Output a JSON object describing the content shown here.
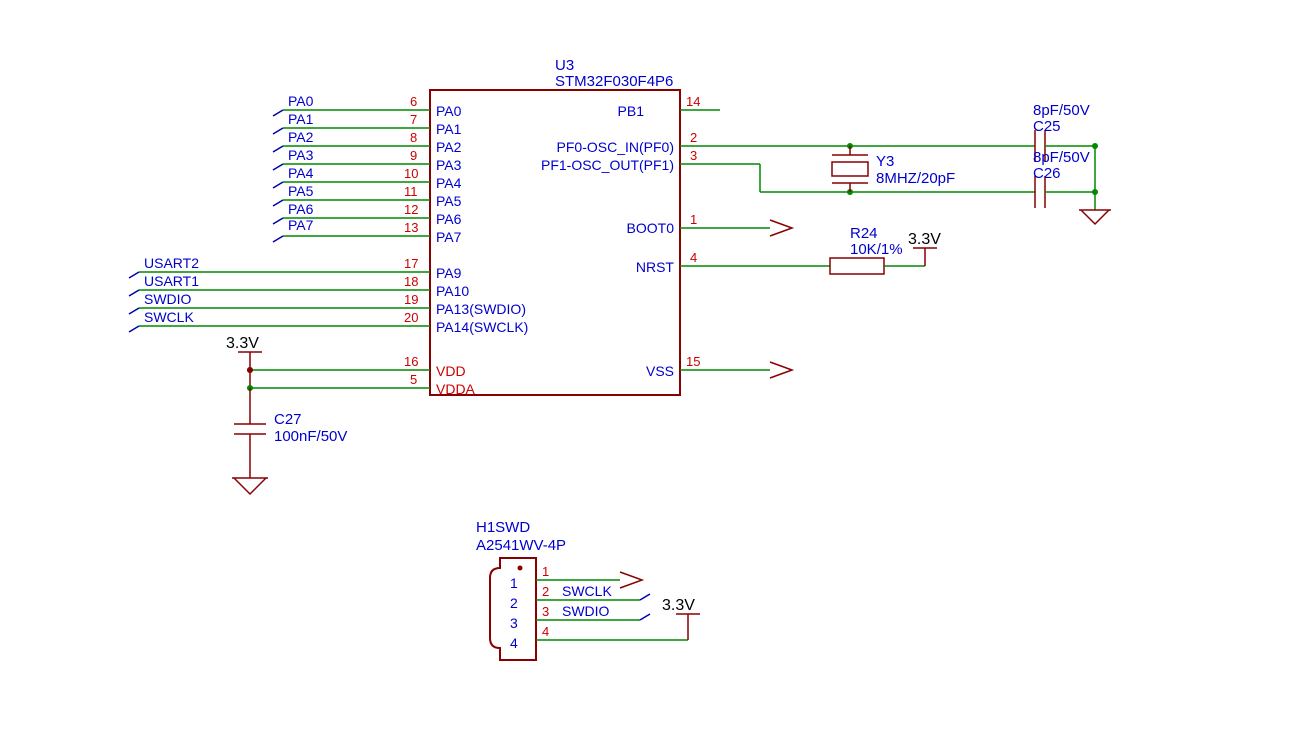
{
  "ic": {
    "ref": "U3",
    "part": "STM32F030F4P6",
    "left_pins": [
      {
        "num": "6",
        "name": "PA0",
        "net": "PA0"
      },
      {
        "num": "7",
        "name": "PA1",
        "net": "PA1"
      },
      {
        "num": "8",
        "name": "PA2",
        "net": "PA2"
      },
      {
        "num": "9",
        "name": "PA3",
        "net": "PA3"
      },
      {
        "num": "10",
        "name": "PA4",
        "net": "PA4"
      },
      {
        "num": "11",
        "name": "PA5",
        "net": "PA5"
      },
      {
        "num": "12",
        "name": "PA6",
        "net": "PA6"
      },
      {
        "num": "13",
        "name": "PA7",
        "net": "PA7"
      },
      {
        "num": "17",
        "name": "PA9",
        "net": "USART2"
      },
      {
        "num": "18",
        "name": "PA10",
        "net": "USART1"
      },
      {
        "num": "19",
        "name": "PA13(SWDIO)",
        "net": "SWDIO"
      },
      {
        "num": "20",
        "name": "PA14(SWCLK)",
        "net": "SWCLK"
      }
    ],
    "pwr_pins": [
      {
        "num": "16",
        "name": "VDD"
      },
      {
        "num": "5",
        "name": "VDDA"
      }
    ],
    "right_pins": {
      "pb1": {
        "num": "14",
        "name": "PB1"
      },
      "osc_in": {
        "num": "2",
        "name": "PF0-OSC_IN(PF0)"
      },
      "osc_out": {
        "num": "3",
        "name": "PF1-OSC_OUT(PF1)"
      },
      "boot0": {
        "num": "1",
        "name": "BOOT0"
      },
      "nrst": {
        "num": "4",
        "name": "NRST"
      },
      "vss": {
        "num": "15",
        "name": "VSS"
      }
    }
  },
  "crystal": {
    "ref": "Y3",
    "value": "8MHZ/20pF"
  },
  "c25": {
    "ref": "C25",
    "value": "8pF/50V"
  },
  "c26": {
    "ref": "C26",
    "value": "8pF/50V"
  },
  "c27": {
    "ref": "C27",
    "value": "100nF/50V"
  },
  "r24": {
    "ref": "R24",
    "value": "10K/1%"
  },
  "v33_top": "3.3V",
  "v33_nrst": "3.3V",
  "v33_swd": "3.3V",
  "swd_header": {
    "ref": "H1SWD",
    "part": "A2541WV-4P",
    "pins": [
      {
        "num": "1",
        "net": ""
      },
      {
        "num": "2",
        "net": "SWCLK"
      },
      {
        "num": "3",
        "net": "SWDIO"
      },
      {
        "num": "4",
        "net": ""
      }
    ]
  }
}
